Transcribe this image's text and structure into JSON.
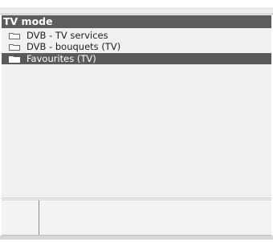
{
  "window": {
    "title": "TV mode"
  },
  "list": {
    "items": [
      {
        "label": "DVB - TV services",
        "icon": "folder-icon",
        "selected": false
      },
      {
        "label": "DVB - bouquets (TV)",
        "icon": "folder-icon",
        "selected": false
      },
      {
        "label": "Favourites (TV)",
        "icon": "folder-icon",
        "selected": true
      }
    ]
  },
  "colors": {
    "title_bar": "#5d5d5d",
    "selection": "#5a5a5a",
    "panel": "#f1f1f1"
  }
}
